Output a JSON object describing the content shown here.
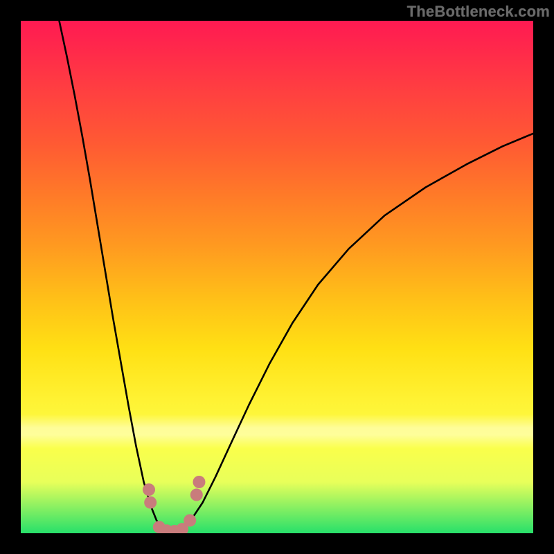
{
  "watermark": "TheBottleneck.com",
  "chart_data": {
    "type": "line",
    "title": "",
    "xlabel": "",
    "ylabel": "",
    "xlim": [
      0,
      1
    ],
    "ylim": [
      0,
      1
    ],
    "notes": "Bottleneck-style curve; x normalized component scale, y normalized bottleneck magnitude. Gradient backdrop: red (bad) at top through yellow to green (good) at bottom. The valley floor near x≈0.29 touches y≈0 (no bottleneck).",
    "series": [
      {
        "name": "curve-left",
        "x": [
          0.075,
          0.09,
          0.105,
          0.12,
          0.135,
          0.15,
          0.165,
          0.18,
          0.195,
          0.21,
          0.225,
          0.24,
          0.255,
          0.265,
          0.275
        ],
        "y": [
          1.0,
          0.93,
          0.855,
          0.775,
          0.69,
          0.6,
          0.51,
          0.42,
          0.335,
          0.25,
          0.17,
          0.1,
          0.05,
          0.025,
          0.012
        ]
      },
      {
        "name": "curve-right",
        "x": [
          0.32,
          0.335,
          0.355,
          0.38,
          0.41,
          0.445,
          0.485,
          0.53,
          0.58,
          0.64,
          0.71,
          0.79,
          0.87,
          0.94,
          1.0
        ],
        "y": [
          0.012,
          0.03,
          0.06,
          0.11,
          0.175,
          0.25,
          0.33,
          0.41,
          0.485,
          0.555,
          0.62,
          0.675,
          0.72,
          0.755,
          0.78
        ]
      },
      {
        "name": "valley-floor",
        "x": [
          0.275,
          0.285,
          0.295,
          0.305,
          0.32
        ],
        "y": [
          0.012,
          0.004,
          0.002,
          0.004,
          0.012
        ]
      }
    ],
    "markers": {
      "name": "pink-dots",
      "color": "#c97c7c",
      "radius_px": 9,
      "points": [
        {
          "x": 0.25,
          "y": 0.085
        },
        {
          "x": 0.253,
          "y": 0.06
        },
        {
          "x": 0.27,
          "y": 0.012
        },
        {
          "x": 0.285,
          "y": 0.005
        },
        {
          "x": 0.3,
          "y": 0.004
        },
        {
          "x": 0.315,
          "y": 0.008
        },
        {
          "x": 0.33,
          "y": 0.025
        },
        {
          "x": 0.343,
          "y": 0.075
        },
        {
          "x": 0.348,
          "y": 0.1
        }
      ]
    },
    "gradient_stops": [
      {
        "pos": 0.0,
        "color": "#ff1a52"
      },
      {
        "pos": 0.25,
        "color": "#ff5a33"
      },
      {
        "pos": 0.55,
        "color": "#ffbf18"
      },
      {
        "pos": 0.8,
        "color": "#fff233"
      },
      {
        "pos": 1.0,
        "color": "#27e06a"
      }
    ]
  }
}
